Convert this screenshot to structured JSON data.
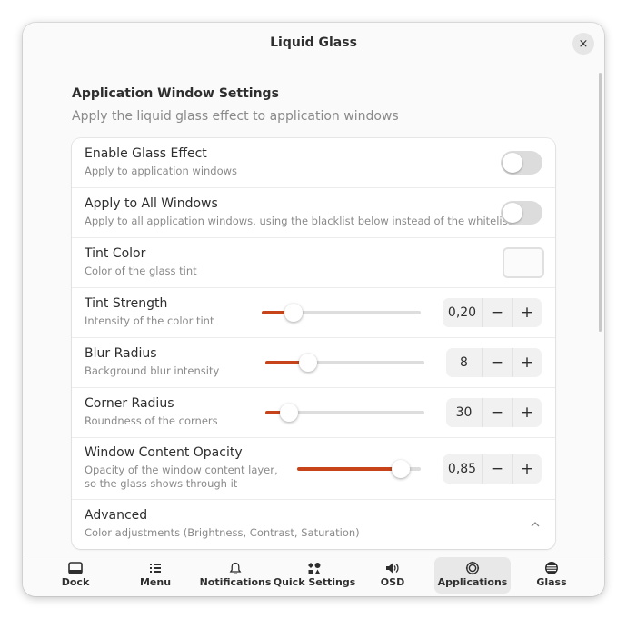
{
  "window": {
    "title": "Liquid Glass",
    "close_icon": "×"
  },
  "section": {
    "title": "Application Window Settings",
    "subtitle": "Apply the liquid glass effect to application windows"
  },
  "settings": [
    {
      "title": "Enable Glass Effect",
      "subtitle": "Apply to application windows",
      "control": "toggle",
      "on": false
    },
    {
      "title": "Apply to All Windows",
      "subtitle": "Apply to all application windows, using the blacklist below instead of the whitelist",
      "control": "toggle",
      "on": false
    },
    {
      "title": "Tint Color",
      "subtitle": "Color of the glass tint",
      "control": "color"
    },
    {
      "title": "Tint Strength",
      "subtitle": "Intensity of the color tint",
      "control": "slider",
      "value": "0,20",
      "fraction": 0.2
    },
    {
      "title": "Blur Radius",
      "subtitle": "Background blur intensity",
      "control": "slider",
      "value": "8",
      "fraction": 0.27
    },
    {
      "title": "Corner Radius",
      "subtitle": "Roundness of the corners",
      "control": "slider",
      "value": "30",
      "fraction": 0.15
    },
    {
      "title": "Window Content Opacity",
      "subtitle_lines": [
        "Opacity of the window content layer,",
        "so the glass shows through it"
      ],
      "control": "slider",
      "value": "0,85",
      "fraction": 0.84
    },
    {
      "title": "Advanced",
      "subtitle": "Color adjustments (Brightness, Contrast, Saturation)",
      "control": "expander"
    }
  ],
  "spin_buttons": {
    "minus": "−",
    "plus": "+"
  },
  "tabs": [
    {
      "label": "Dock",
      "icon": "dock-icon",
      "active": false
    },
    {
      "label": "Menu",
      "icon": "menu-icon",
      "active": false
    },
    {
      "label": "Notifications",
      "icon": "bell-icon",
      "active": false
    },
    {
      "label": "Quick Settings",
      "icon": "quick-settings-icon",
      "active": false
    },
    {
      "label": "OSD",
      "icon": "speaker-icon",
      "active": false
    },
    {
      "label": "Applications",
      "icon": "applications-icon",
      "active": true
    },
    {
      "label": "Glass",
      "icon": "glass-icon",
      "active": false
    }
  ],
  "colors": {
    "accent": "#c7441a",
    "toggle_off": "#dcdcdc"
  }
}
